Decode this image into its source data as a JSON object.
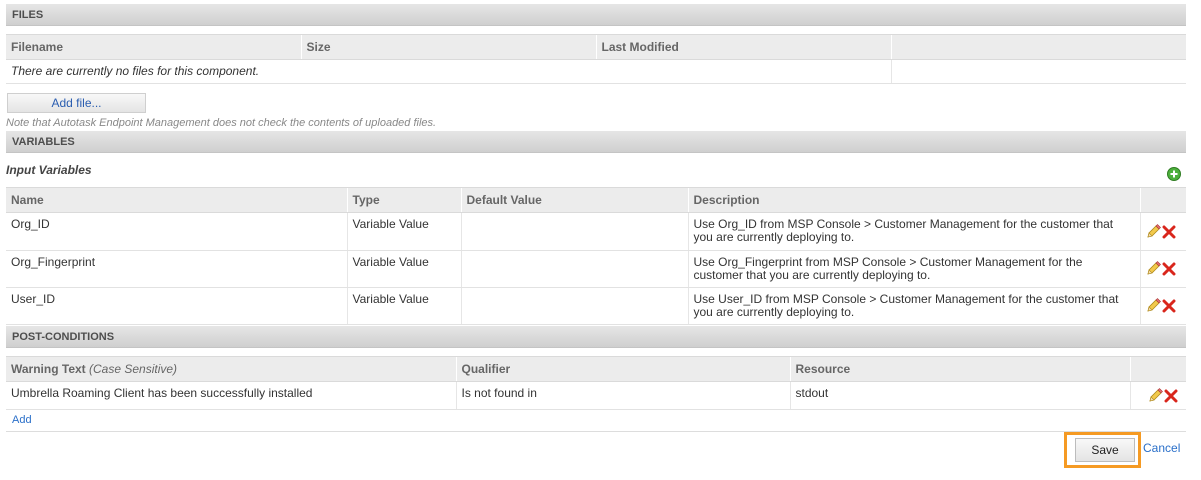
{
  "files": {
    "section_title": "FILES",
    "columns": [
      "Filename",
      "Size",
      "Last Modified"
    ],
    "empty_message": "There are currently no files for this component.",
    "add_button": "Add file...",
    "note": "Note that Autotask Endpoint Management does not check the contents of uploaded files."
  },
  "variables": {
    "section_title": "VARIABLES",
    "subtitle": "Input Variables",
    "columns": [
      "Name",
      "Type",
      "Default Value",
      "Description"
    ],
    "rows": [
      {
        "name": "Org_ID",
        "type": "Variable Value",
        "default": "",
        "description": "Use Org_ID from MSP Console > Customer Management for the customer that you are currently deploying to."
      },
      {
        "name": "Org_Fingerprint",
        "type": "Variable Value",
        "default": "",
        "description": "Use Org_Fingerprint from MSP Console > Customer Management for the customer that you are currently deploying to."
      },
      {
        "name": "User_ID",
        "type": "Variable Value",
        "default": "",
        "description": "Use User_ID from MSP Console > Customer Management for the customer that you are currently deploying to."
      }
    ]
  },
  "postconditions": {
    "section_title": "POST-CONDITIONS",
    "col_warning": "Warning Text",
    "col_warning_note": "(Case Sensitive)",
    "col_qualifier": "Qualifier",
    "col_resource": "Resource",
    "rows": [
      {
        "warning": "Umbrella Roaming Client has been successfully installed",
        "qualifier": "Is not found in",
        "resource": "stdout"
      }
    ],
    "add_link": "Add"
  },
  "footer": {
    "save_label": "Save",
    "cancel_label": "Cancel",
    "highlight_color": "#f59a23"
  },
  "icons": {
    "add": "plus-circle-icon",
    "edit": "pencil-icon",
    "delete": "delete-x-icon"
  }
}
